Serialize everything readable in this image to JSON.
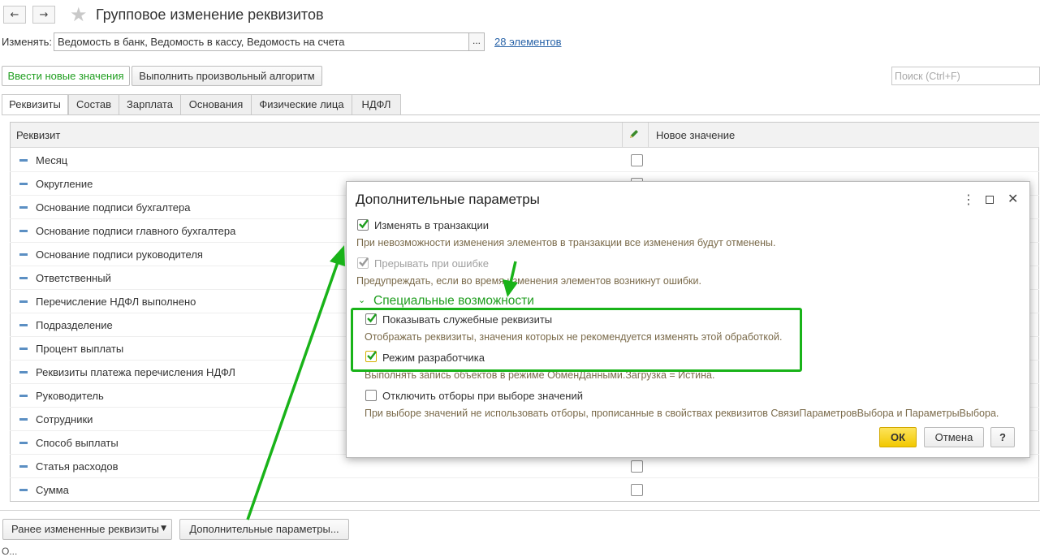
{
  "header": {
    "title": "Групповое изменение реквизитов",
    "change_label": "Изменять:",
    "change_value": "Ведомость в банк, Ведомость в кассу, Ведомость на счета",
    "choose_button": "...",
    "elements_link": "28 элементов"
  },
  "toolbar": {
    "enter_values": "Ввести новые значения",
    "run_algorithm": "Выполнить произвольный алгоритм",
    "search_placeholder": "Поиск (Ctrl+F)"
  },
  "tabs": [
    "Реквизиты",
    "Состав",
    "Зарплата",
    "Основания",
    "Физические лица",
    "НДФЛ"
  ],
  "table": {
    "col_attribute": "Реквизит",
    "col_new_value": "Новое значение",
    "rows": [
      "Месяц",
      "Округление",
      "Основание подписи бухгалтера",
      "Основание подписи главного бухгалтера",
      "Основание подписи руководителя",
      "Ответственный",
      "Перечисление НДФЛ выполнено",
      "Подразделение",
      "Процент выплаты",
      "Реквизиты платежа перечисления НДФЛ",
      "Руководитель",
      "Сотрудники",
      "Способ выплаты",
      "Статья расходов",
      "Сумма"
    ]
  },
  "bottom": {
    "previous_attrs": "Ранее измененные реквизиты",
    "extra_params": "Дополнительные параметры...",
    "footer_text": "О..."
  },
  "dialog": {
    "title": "Дополнительные параметры",
    "change_in_transaction": "Изменять в транзакции",
    "change_in_transaction_checked": true,
    "change_in_transaction_hint": "При невозможности изменения элементов в транзакции все изменения будут отменены.",
    "abort_on_error": "Прерывать при ошибке",
    "abort_on_error_checked": true,
    "abort_on_error_hint": "Предупреждать, если во время изменения элементов возникнут ошибки.",
    "section_special": "Специальные возможности",
    "show_service": "Показывать служебные реквизиты",
    "show_service_checked": true,
    "show_service_hint": "Отображать реквизиты, значения которых не рекомендуется изменять этой обработкой.",
    "dev_mode": "Режим разработчика",
    "dev_mode_checked": true,
    "dev_mode_hint": "Выполнять запись объектов в режиме ОбменДанными.Загрузка = Истина.",
    "disable_filters": "Отключить отборы при выборе значений",
    "disable_filters_checked": false,
    "disable_filters_hint": "При выборе значений не использовать отборы, прописанные в свойствах реквизитов СвязиПараметровВыбора и ПараметрыВыбора.",
    "ok": "ОК",
    "cancel": "Отмена",
    "help": "?"
  },
  "colors": {
    "accent_green": "#1f9e1f",
    "highlight_green": "#19b319",
    "ok_yellow": "#f5d21a",
    "link_blue": "#2a64a8"
  }
}
